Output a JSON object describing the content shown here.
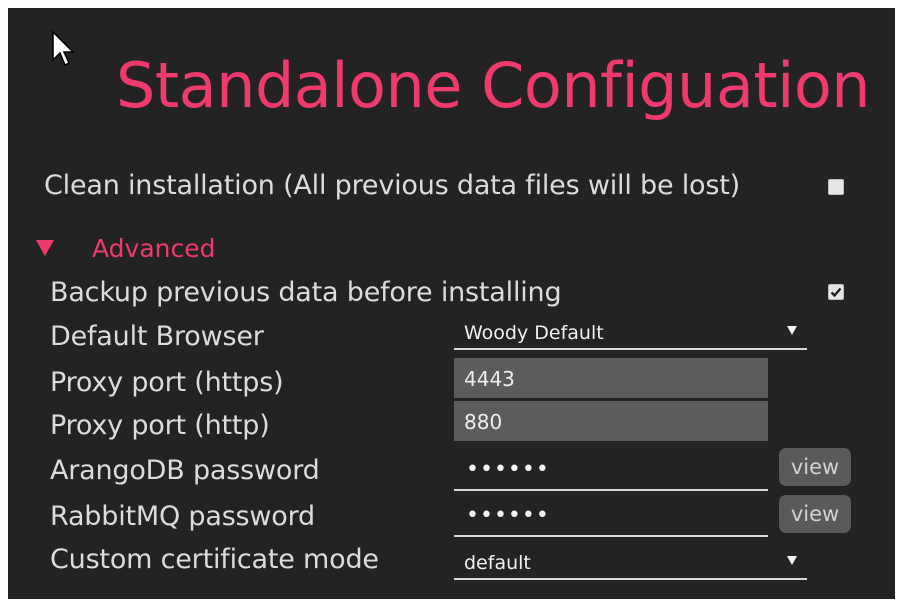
{
  "title": "Standalone Configuation",
  "clean_install": {
    "label": "Clean installation (All previous data files will be lost)",
    "checked": false
  },
  "advanced": {
    "label": "Advanced",
    "expanded": true,
    "backup": {
      "label": "Backup previous data before installing",
      "checked": true
    },
    "default_browser": {
      "label": "Default Browser",
      "value": "Woody Default"
    },
    "proxy_https": {
      "label": "Proxy port (https)",
      "value": "4443"
    },
    "proxy_http": {
      "label": "Proxy port (http)",
      "value": "880"
    },
    "arangodb_password": {
      "label": "ArangoDB password",
      "value": "••••••",
      "view_label": "view"
    },
    "rabbitmq_password": {
      "label": "RabbitMQ password",
      "value": "••••••",
      "view_label": "view"
    },
    "certificate_mode": {
      "label": "Custom certificate mode",
      "value": "default"
    }
  },
  "icons": {
    "cursor": "mouse-pointer-icon",
    "advanced_toggle": "triangle-down-icon",
    "dropdown": "caret-down-icon",
    "checkmark": "checkmark-icon"
  },
  "colors": {
    "background": "#232323",
    "accent": "#ee3a6d",
    "text": "#dcdcdc",
    "input_bg": "#5c5c5c",
    "button_bg": "#5a5a5a"
  }
}
